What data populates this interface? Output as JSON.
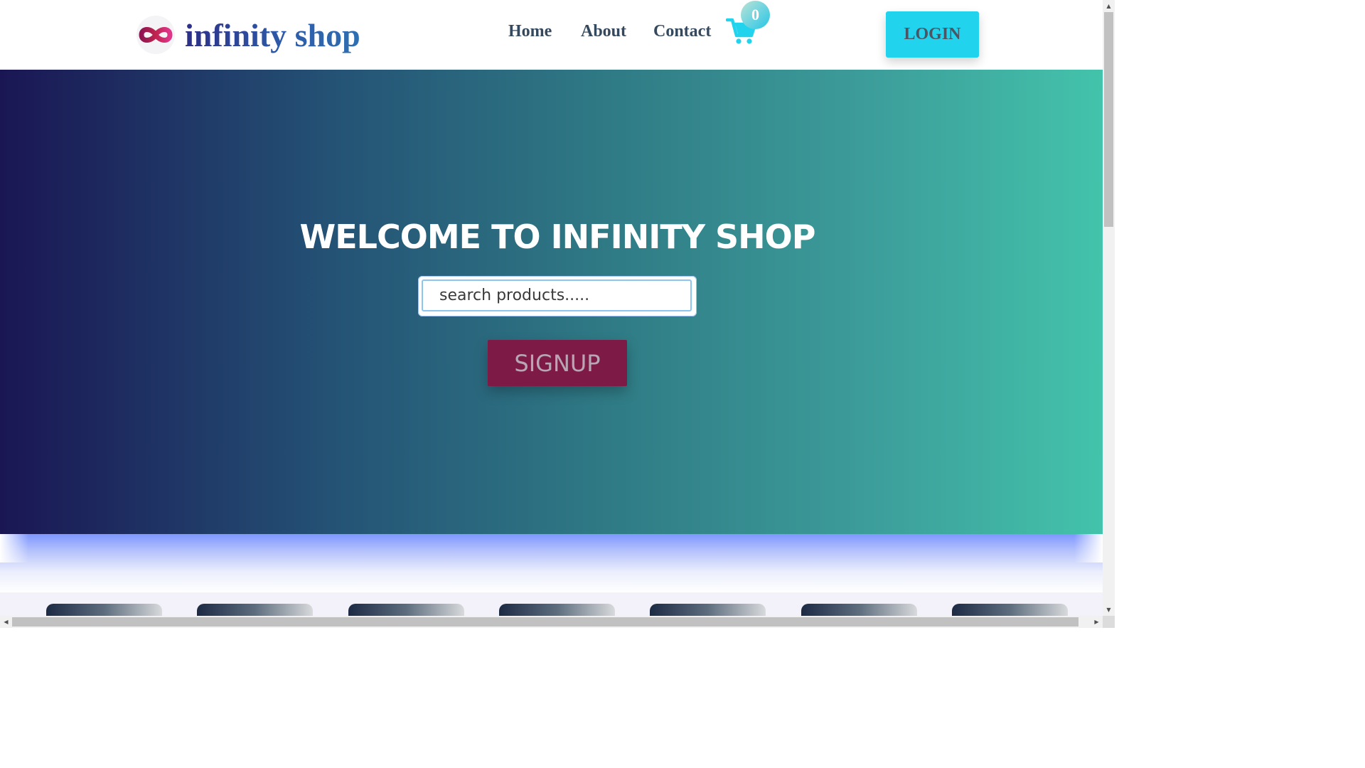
{
  "header": {
    "brand": "infinity shop",
    "nav": {
      "home": "Home",
      "about": "About",
      "contact": "Contact"
    },
    "cart_count": "0",
    "login_label": "LOGIN"
  },
  "hero": {
    "title": "WELCOME TO INFINITY SHOP",
    "search_placeholder": "search products.....",
    "signup_label": "SIGNUP"
  },
  "colors": {
    "accent_cyan": "#22d3ee",
    "signup_maroon": "#7d1a45",
    "hero_start": "#1a1654",
    "hero_end": "#43c3ab"
  },
  "icons": {
    "logo": "infinity-icon",
    "cart": "shopping-cart-icon"
  },
  "products": {
    "visible_cards": 7
  }
}
